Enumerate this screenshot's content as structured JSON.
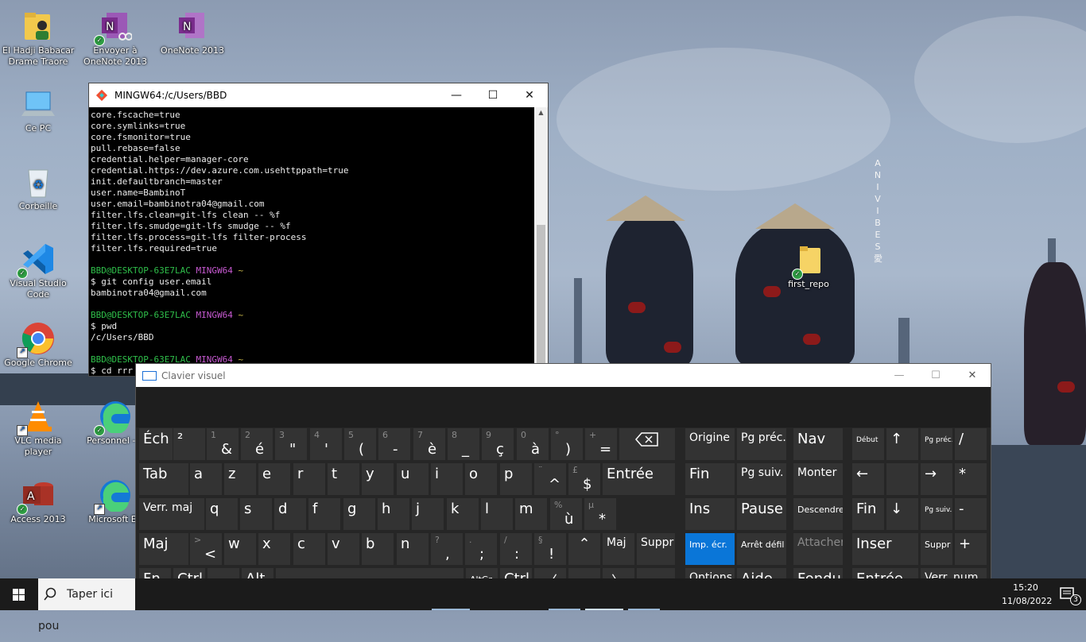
{
  "desktop": {
    "icons": [
      {
        "label": "El Hadji Babacar\nDrame Traore"
      },
      {
        "label": "Envoyer à\nOneNote 2013"
      },
      {
        "label": "OneNote 2013"
      },
      {
        "label": "Ce PC"
      },
      {
        "label": "Corbeille"
      },
      {
        "label": "Visual Studio\nCode"
      },
      {
        "label": "Google Chrome"
      },
      {
        "label": "VLC media player"
      },
      {
        "label": "Personnel - E"
      },
      {
        "label": "Access 2013"
      },
      {
        "label": "Microsoft Ed"
      },
      {
        "label": "first_repo"
      }
    ],
    "wallpaper_text": "A\nN\nI\nV\nI\nB\nE\nS\n愛"
  },
  "terminal": {
    "title": "MINGW64:/c/Users/BBD",
    "lines": [
      {
        "t": "core.fscache=true"
      },
      {
        "t": "core.symlinks=true"
      },
      {
        "t": "core.fsmonitor=true"
      },
      {
        "t": "pull.rebase=false"
      },
      {
        "t": "credential.helper=manager-core"
      },
      {
        "t": "credential.https://dev.azure.com.usehttppath=true"
      },
      {
        "t": "init.defaultbranch=master"
      },
      {
        "t": "user.name=BambinoT"
      },
      {
        "t": "user.email=bambinotra04@gmail.com"
      },
      {
        "t": "filter.lfs.clean=git-lfs clean -- %f"
      },
      {
        "t": "filter.lfs.smudge=git-lfs smudge -- %f"
      },
      {
        "t": "filter.lfs.process=git-lfs filter-process"
      },
      {
        "t": "filter.lfs.required=true"
      },
      {
        "t": ""
      },
      {
        "prompt": true,
        "user": "BBD@DESKTOP-63E7LAC",
        "sys": "MINGW64",
        "path": "~"
      },
      {
        "t": "$ git config user.email"
      },
      {
        "t": "bambinotra04@gmail.com"
      },
      {
        "t": ""
      },
      {
        "prompt": true,
        "user": "BBD@DESKTOP-63E7LAC",
        "sys": "MINGW64",
        "path": "~"
      },
      {
        "t": "$ pwd"
      },
      {
        "t": "/c/Users/BBD"
      },
      {
        "t": ""
      },
      {
        "prompt": true,
        "user": "BBD@DESKTOP-63E7LAC",
        "sys": "MINGW64",
        "path": "~"
      },
      {
        "t": "$ cd rrr"
      }
    ]
  },
  "osk": {
    "title": "Clavier visuel",
    "keys": {
      "ech": "Éch",
      "sup2": "²",
      "n1": {
        "shift": "1",
        "main": "&"
      },
      "n2": {
        "shift": "2",
        "main": "é"
      },
      "n3": {
        "shift": "3",
        "main": "\""
      },
      "n4": {
        "shift": "4",
        "main": "'"
      },
      "n5": {
        "shift": "5",
        "main": "("
      },
      "n6": {
        "shift": "6",
        "main": "-"
      },
      "n7": {
        "shift": "7",
        "main": "è"
      },
      "n8": {
        "shift": "8",
        "main": "_"
      },
      "n9": {
        "shift": "9",
        "main": "ç"
      },
      "n0": {
        "shift": "0",
        "main": "à"
      },
      "deg": {
        "shift": "°",
        "main": ")"
      },
      "plus": {
        "shift": "+",
        "main": "="
      },
      "tab": "Tab",
      "a": "a",
      "z": "z",
      "e": "e",
      "r": "r",
      "t": "t",
      "y": "y",
      "u": "u",
      "i": "i",
      "o": "o",
      "p": "p",
      "circ": {
        "shift": "¨",
        "main": "^"
      },
      "pound": {
        "shift": "£",
        "main": "$"
      },
      "entree": "Entrée",
      "verrmaj": "Verr. maj",
      "q": "q",
      "s": "s",
      "d": "d",
      "f": "f",
      "g": "g",
      "h": "h",
      "j": "j",
      "k": "k",
      "l": "l",
      "m": "m",
      "pct": {
        "shift": "%",
        "main": "ù"
      },
      "mu": {
        "shift": "µ",
        "main": "*"
      },
      "maj": "Maj",
      "lt": {
        "shift": ">",
        "main": "<"
      },
      "w": "w",
      "x": "x",
      "c": "c",
      "v": "v",
      "b": "b",
      "n": "n",
      "comma": {
        "shift": "?",
        "main": ","
      },
      "semi": {
        "shift": ".",
        "main": ";"
      },
      "colon": {
        "shift": "/",
        "main": ":"
      },
      "excl": {
        "shift": "§",
        "main": "!"
      },
      "up": "⌃",
      "maj2": "Maj",
      "suppr": "Suppr",
      "fn": "Fn",
      "ctrl": "Ctrl",
      "alt": "Alt",
      "altgr": "AltGr",
      "ctrl2": "Ctrl",
      "left": "〈",
      "down": "⌄",
      "right": "〉",
      "origine": "Origine",
      "pgprec": "Pg préc.",
      "nav": "Nav",
      "fin": "Fin",
      "pgsuiv": "Pg suiv.",
      "monter": "Monter",
      "ins": "Ins",
      "pause": "Pause",
      "descendre": "Descendre",
      "impecr": "Imp. écr.",
      "arretdefil": "Arrêt défil",
      "attacher": "Attacher",
      "options": "Options",
      "aide": "Aide",
      "fondu": "Fondu",
      "debut": "Début",
      "np_up": "↑",
      "np_pgprec": "Pg préc.",
      "np_slash": "/",
      "np_left": "←",
      "np_right": "→",
      "np_star": "*",
      "np_fin": "Fin",
      "np_down": "↓",
      "np_pgsuiv": "Pg suiv.",
      "np_minus": "-",
      "inser": "Inser",
      "np_suppr": "Suppr",
      "np_plus": "+",
      "np_entree": "Entrée",
      "verrnum": "Verr. num"
    }
  },
  "taskbar": {
    "search_placeholder": "Taper ici pou",
    "time": "15:20",
    "date": "11/08/2022",
    "notifications": "3"
  },
  "colors": {
    "prompt_user": "#2fbf4a",
    "prompt_sys": "#c659d0",
    "prompt_path": "#c9b84a",
    "osk_active_key": "#0a76d8"
  }
}
